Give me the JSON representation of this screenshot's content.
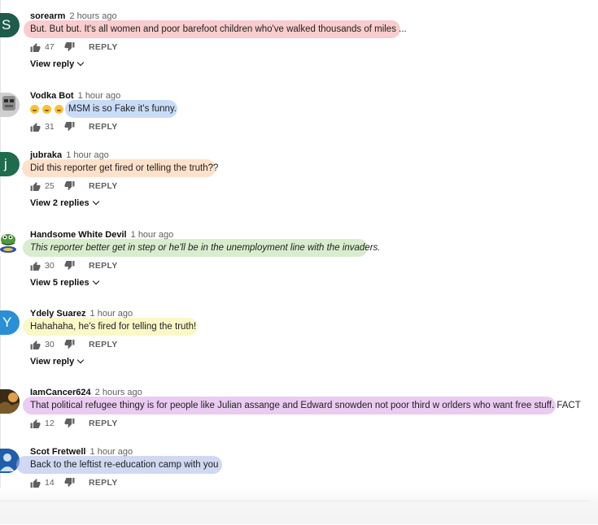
{
  "comments": [
    {
      "author": "sorearm",
      "time": "2 hours ago",
      "text": "But. But  but. It's all women and poor barefoot children who've walked thousands of miles  ...",
      "likes": "47",
      "reply_label": "REPLY",
      "view_replies": "View reply",
      "avatar_letter": "S",
      "avatar_color": "#1e5b4b",
      "highlight_color": "#f4a3a6"
    },
    {
      "author": "Vodka Bot",
      "time": "1 hour ago",
      "text": "MSM is so Fake it's funny.",
      "likes": "31",
      "reply_label": "REPLY",
      "avatar_color": "#a8a8a8",
      "highlight_color": "#9dc0f0"
    },
    {
      "author": "jubraka",
      "time": "1 hour ago",
      "text": "Did this reporter get fired or telling the truth??",
      "likes": "25",
      "reply_label": "REPLY",
      "view_replies": "View 2 replies",
      "avatar_letter": "j",
      "avatar_color": "#1e6b4e",
      "highlight_color": "#fbc8a0"
    },
    {
      "author": "Handsome White Devil",
      "time": "1 hour ago",
      "text": "This reporter better get in step or he'll be in the unemployment line with the invaders.",
      "likes": "30",
      "reply_label": "REPLY",
      "view_replies": "View 5 replies",
      "avatar_color": "#4f9a3a",
      "highlight_color": "#b8dfa6"
    },
    {
      "author": "Ydely Suarez",
      "time": "1 hour ago",
      "text": "Hahahaha, he's fired for telling the truth!",
      "likes": "30",
      "reply_label": "REPLY",
      "view_replies": "View reply",
      "avatar_letter": "Y",
      "avatar_color": "#2a8fd6",
      "highlight_color": "#f8f39a"
    },
    {
      "author": "IamCancer624",
      "time": "2 hours ago",
      "text": "That political refugee thingy is for people like Julian assange and Edward snowden not poor third w orlders who want free stuff. FACT",
      "likes": "12",
      "reply_label": "REPLY",
      "avatar_color": "#7a5a2a",
      "highlight_color": "#d8a0e6"
    },
    {
      "author": "Scot Fretwell",
      "time": "1 hour ago",
      "text": "Back to the leftist re-education camp with you",
      "likes": "14",
      "reply_label": "REPLY",
      "avatar_color": "#1f5ea8",
      "highlight_color": "#a9b8e8"
    }
  ],
  "icons": {
    "like": "thumbs-up-icon",
    "dislike": "thumbs-down-icon",
    "view_replies": "chevron-down-icon"
  }
}
